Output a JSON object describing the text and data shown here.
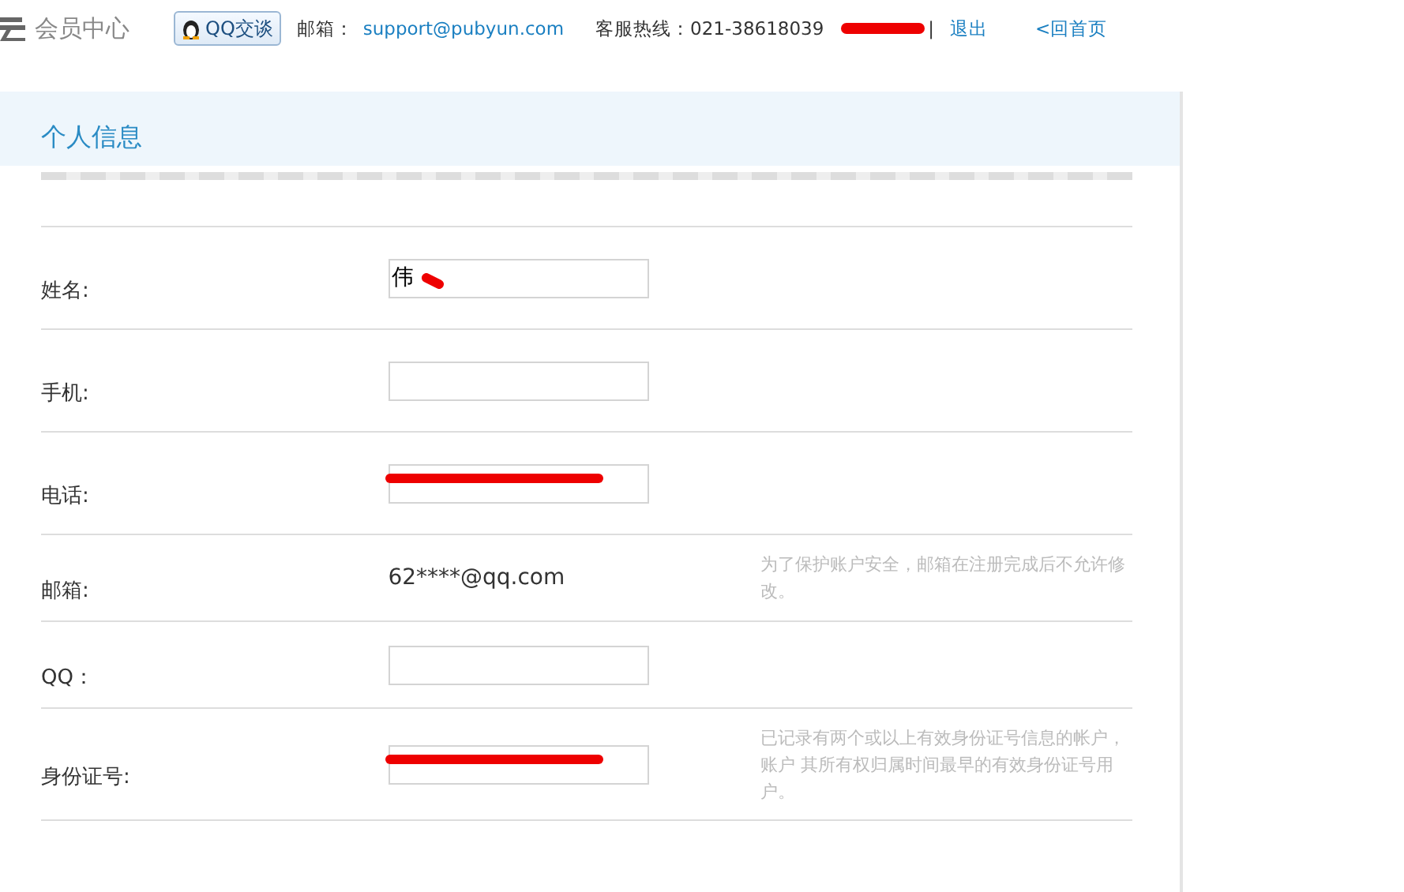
{
  "header": {
    "site_title": "会员中心",
    "chat_button": "QQ交谈",
    "email_label": "邮箱：",
    "email": "support@pubyun.com",
    "hotline": "客服热线：021-38618039",
    "user_redacted": true,
    "separator": "|",
    "logout": "退出",
    "home": "<回首页"
  },
  "section": {
    "title": "个人信息"
  },
  "rows": [
    {
      "label": "姓名:",
      "kind": "input",
      "value": "伟",
      "redacted": true
    },
    {
      "label": "手机:",
      "kind": "input",
      "redacted": false
    },
    {
      "label": "电话:",
      "kind": "input",
      "redacted": true
    },
    {
      "label": "邮箱:",
      "kind": "text",
      "value": "62****@qq.com",
      "hint": "为了保护账户安全，邮箱在注册完成后不允许修改。",
      "redacted": false
    },
    {
      "label": "QQ：",
      "kind": "input",
      "redacted": false
    },
    {
      "label": "身份证号:",
      "kind": "input",
      "hint": "已记录有两个或以上有效身份证号信息的帐户，账户 其所有权归属时间最早的有效身份证号用户。",
      "redacted": true
    }
  ]
}
